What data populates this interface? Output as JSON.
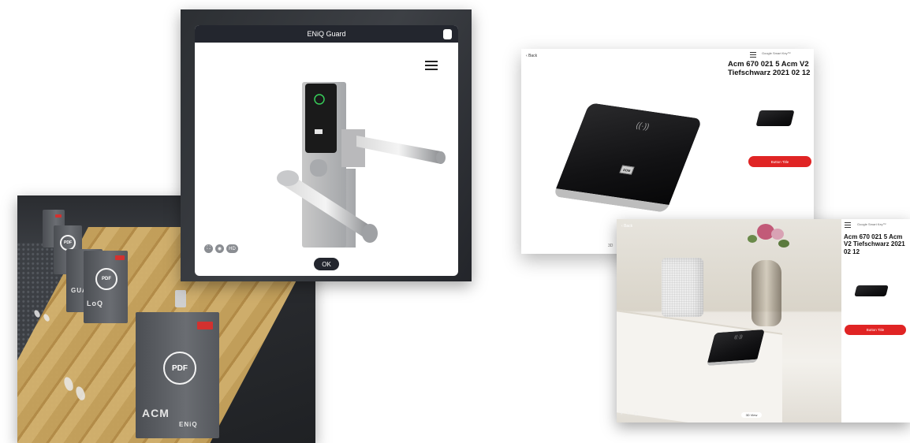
{
  "viewer": {
    "title": "ENiQ Guard",
    "ok_label": "OK",
    "controls": [
      "⛶",
      "◉",
      "HD"
    ]
  },
  "showroom": {
    "stand_icon_text": "PDF",
    "stand_labels": [
      "ACM",
      "ENiQ",
      "LoQ",
      "GUARD"
    ]
  },
  "product": {
    "back_label": "Back",
    "header": "Google Smart Key™",
    "title": "Acm 670 021 5 Acm V2 Tiefschwarz 2021 02 12",
    "buy_label": "Button Title",
    "view_label": "3D",
    "device_label": "DOM"
  },
  "ar": {
    "back_label": "Back",
    "header": "Google Smart Key™",
    "title": "Acm 670 021 5 Acm V2 Tiefschwarz 2021 02 12",
    "buy_label": "Button Title",
    "bottom_controls": [
      "⏸",
      "↻",
      "◯"
    ],
    "pill_label": "3D View"
  },
  "colors": {
    "accent_red": "#e02424",
    "dark_bar": "#23262e"
  }
}
